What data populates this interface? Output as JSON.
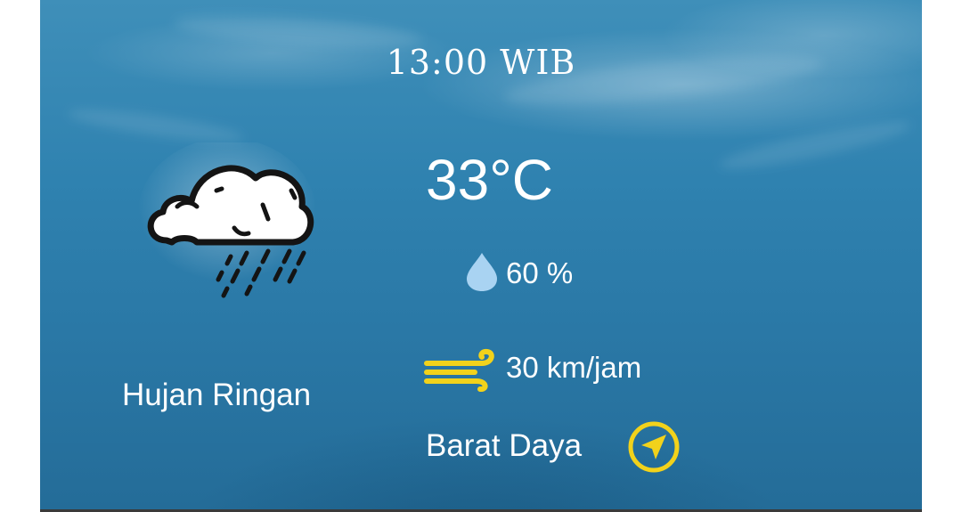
{
  "weather": {
    "time": "13:00 WIB",
    "temperature": "33°C",
    "humidity": "60 %",
    "wind_speed": "30 km/jam",
    "condition": "Hujan Ringan",
    "wind_direction": "Barat Daya"
  },
  "icons": {
    "condition": "rain-cloud-icon",
    "humidity": "water-drop-icon",
    "wind": "wind-icon",
    "direction": "compass-arrow-icon"
  },
  "colors": {
    "accent_yellow": "#f2d21b",
    "drop_blue": "#a9d3f2",
    "text": "#ffffff"
  }
}
